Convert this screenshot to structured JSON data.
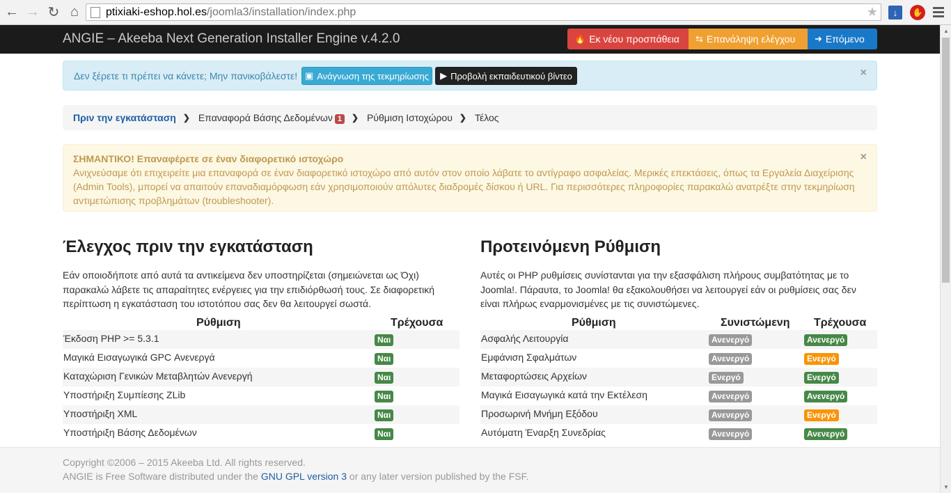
{
  "browser": {
    "url_host": "ptixiaki-eshop.hol.es",
    "url_path": "/joomla3/installation/index.php"
  },
  "topbar": {
    "brand": "ANGIE – Akeeba Next Generation Installer Engine v.4.2.0",
    "btn_retry": "Εκ νέου προσπάθεια",
    "btn_recheck": "Επανάληψη ελέγχου",
    "btn_next": "Επόμενο"
  },
  "info": {
    "text": "Δεν ξέρετε τι πρέπει να κάνετε; Μην πανικοβάλεστε!",
    "btn_docs": "Ανάγνωση της τεκμηρίωσης",
    "btn_video": "Προβολή εκπαιδευτικού βίντεο"
  },
  "crumbs": {
    "step1": "Πριν την εγκατάσταση",
    "step2": "Επαναφορά Βάσης Δεδομένων",
    "step2_badge": "1",
    "step3": "Ρύθμιση Ιστοχώρου",
    "step4": "Τέλος"
  },
  "warning": {
    "title": "ΣΗΜΑΝΤΙΚΟ! Επαναφέρετε σε έναν διαφορετικό ιστοχώρο",
    "body": "Ανιχνεύσαμε ότι επιχειρείτε μια επαναφορά σε έναν διαφορετικό ιστοχώρο από αυτόν στον οποίο λάβατε το αντίγραφο ασφαλείας. Μερικές επεκτάσεις, όπως τα Εργαλεία Διαχείρισης (Admin Tools), μπορεί να απαιτούν επαναδιαμόρφωση εάν χρησιμοποιούν απόλυτες διαδρομές δίσκου ή URL. Για περισσότερες πληροφορίες παρακαλώ ανατρέξτε στην τεκμηρίωση αντιμετώπισης προβλημάτων (troubleshooter)."
  },
  "left": {
    "title": "Έλεγχος πριν την εγκατάσταση",
    "desc": "Εάν οποιοδήποτε από αυτά τα αντικείμενα δεν υποστηρίζεται (σημειώνεται ως Όχι) παρακαλώ λάβετε τις απαραίτητες ενέργειες για την επιδιόρθωσή τους. Σε διαφορετική περίπτωση η εγκατάσταση του ιστοτόπου σας δεν θα λειτουργεί σωστά.",
    "col_setting": "Ρύθμιση",
    "col_current": "Τρέχουσα",
    "rows": [
      {
        "label": "Έκδοση PHP >= 5.3.1",
        "current": "Ναι"
      },
      {
        "label": "Μαγικά Εισαγωγικά GPC Ανενεργά",
        "current": "Ναι"
      },
      {
        "label": "Καταχώριση Γενικών Μεταβλητών Ανενεργή",
        "current": "Ναι"
      },
      {
        "label": "Υποστήριξη Συμπίεσης ZLib",
        "current": "Ναι"
      },
      {
        "label": "Υποστήριξη XML",
        "current": "Ναι"
      },
      {
        "label": "Υποστήριξη Βάσης Δεδομένων",
        "current": "Ναι"
      }
    ]
  },
  "right": {
    "title": "Προτεινόμενη Ρύθμιση",
    "desc": "Αυτές οι PHP ρυθμίσεις συνίστανται για την εξασφάλιση πλήρους συμβατότητας με το Joomla!. Πάραυτα, το Joomla! θα εξακολουθήσει να λειτουργεί εάν οι ρυθμίσεις σας δεν είναι πλήρως εναρμονισμένες με τις συνιστώμενες.",
    "col_setting": "Ρύθμιση",
    "col_recommended": "Συνιστώμενη",
    "col_current": "Τρέχουσα",
    "rows": [
      {
        "label": "Ασφαλής Λειτουργία",
        "recommended": "Ανενεργό",
        "current": "Ανενεργό",
        "current_color": "green"
      },
      {
        "label": "Εμφάνιση Σφαλμάτων",
        "recommended": "Ανενεργό",
        "current": "Ενεργό",
        "current_color": "orange"
      },
      {
        "label": "Μεταφορτώσεις Αρχείων",
        "recommended": "Ενεργό",
        "current": "Ενεργό",
        "current_color": "green"
      },
      {
        "label": "Μαγικά Εισαγωγικά κατά την Εκτέλεση",
        "recommended": "Ανενεργό",
        "current": "Ανενεργό",
        "current_color": "green"
      },
      {
        "label": "Προσωρινή Μνήμη Εξόδου",
        "recommended": "Ανενεργό",
        "current": "Ενεργό",
        "current_color": "orange"
      },
      {
        "label": "Αυτόματη Έναρξη Συνεδρίας",
        "recommended": "Ανενεργό",
        "current": "Ανενεργό",
        "current_color": "green"
      }
    ]
  },
  "footer": {
    "copyright": "Copyright ©2006 – 2015 Akeeba Ltd. All rights reserved.",
    "license_pre": "ANGIE is Free Software distributed under the",
    "license_link": "GNU GPL version 3",
    "license_post": "or any later version published by the FSF."
  }
}
